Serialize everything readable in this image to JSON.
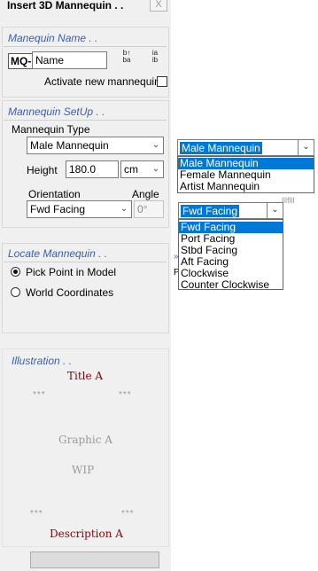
{
  "window": {
    "title": "Insert 3D Mannequin . .",
    "close_glyph": "X"
  },
  "name_section": {
    "title": "Manequin Name . .",
    "prefix": "MQ-",
    "name_value": "Name",
    "sort_az_label": "b↕\nba",
    "sort_za_label": "ia\nib",
    "activate_label": "Activate new mannequin",
    "activate_checked": false
  },
  "setup_section": {
    "title": "Mannequin SetUp . .",
    "type_label": "Mannequin Type",
    "type_value": "Male Mannequin",
    "height_label": "Height",
    "height_value": "180.0",
    "unit_value": "cm",
    "orientation_label": "Orientation",
    "orientation_value": "Fwd Facing",
    "angle_label": "Angle",
    "angle_value": "0°"
  },
  "type_dropdown": {
    "selected": "Male Mannequin",
    "options": [
      "Male Mannequin",
      "Female Mannequin",
      "Artist Mannequin"
    ]
  },
  "orientation_dropdown": {
    "selected": "Fwd Facing",
    "options": [
      "Fwd Facing",
      "Port Facing",
      "Stbd Facing",
      "Aft Facing",
      "Clockwise",
      "Counter Clockwise"
    ]
  },
  "locate_section": {
    "title": "Locate Mannequin . .",
    "options": [
      "Pick Point in Model",
      "World Coordinates"
    ],
    "selected_index": 0
  },
  "illustration": {
    "title": "Illustration . .",
    "heading": "Title A",
    "graphic": "Graphic A",
    "wip": "WIP",
    "description": "Description A",
    "stars": "***"
  },
  "colors": {
    "accent": "#3a5eb5",
    "selection": "#0078d7",
    "illustration_red": "#8b0000"
  }
}
